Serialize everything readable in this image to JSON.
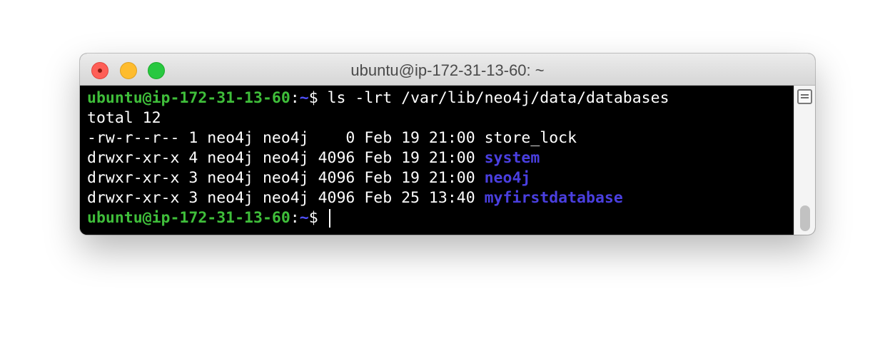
{
  "window": {
    "title": "ubuntu@ip-172-31-13-60: ~"
  },
  "colors": {
    "prompt_user": "#3fbe3a",
    "prompt_path": "#5050ff",
    "directory": "#4a3fe0",
    "text": "#ffffff",
    "background": "#000000"
  },
  "terminal": {
    "prompt_user_host": "ubuntu@ip-172-31-13-60",
    "prompt_colon": ":",
    "prompt_path": "~",
    "prompt_dollar": "$ ",
    "command": "ls -lrt /var/lib/neo4j/data/databases",
    "total_line": "total 12",
    "entries": [
      {
        "meta": "-rw-r--r-- 1 neo4j neo4j    0 Feb 19 21:00 ",
        "name": "store_lock",
        "is_dir": false
      },
      {
        "meta": "drwxr-xr-x 4 neo4j neo4j 4096 Feb 19 21:00 ",
        "name": "system",
        "is_dir": true
      },
      {
        "meta": "drwxr-xr-x 3 neo4j neo4j 4096 Feb 19 21:00 ",
        "name": "neo4j",
        "is_dir": true
      },
      {
        "meta": "drwxr-xr-x 3 neo4j neo4j 4096 Feb 25 13:40 ",
        "name": "myfirstdatabase",
        "is_dir": true
      }
    ]
  },
  "icons": {
    "close": "close-icon",
    "minimize": "minimize-icon",
    "zoom": "zoom-icon",
    "scroll_toggle": "list-icon"
  }
}
